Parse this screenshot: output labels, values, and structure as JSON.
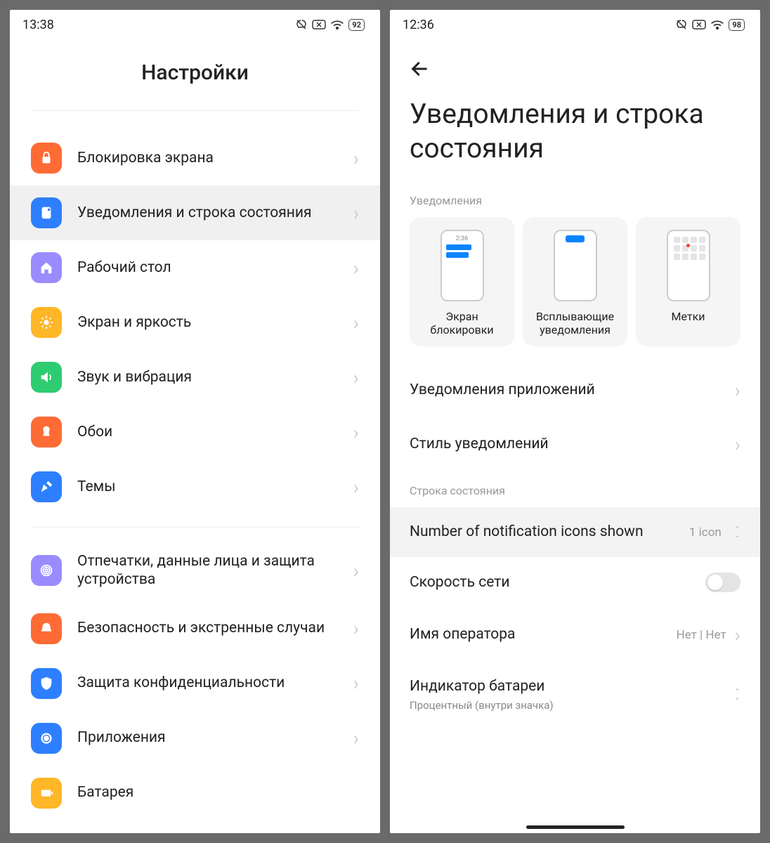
{
  "left": {
    "status": {
      "time": "13:38",
      "battery": "92"
    },
    "title": "Настройки",
    "group1": [
      {
        "id": "lock",
        "label": "Блокировка экрана",
        "color": "#ff6b35"
      },
      {
        "id": "notif",
        "label": "Уведомления и строка состояния",
        "color": "#2e7fff",
        "selected": true
      },
      {
        "id": "home",
        "label": "Рабочий стол",
        "color": "#9a8cff"
      },
      {
        "id": "display",
        "label": "Экран и яркость",
        "color": "#ffb627"
      },
      {
        "id": "sound",
        "label": "Звук и вибрация",
        "color": "#2ecc71"
      },
      {
        "id": "wallpaper",
        "label": "Обои",
        "color": "#ff6b35"
      },
      {
        "id": "themes",
        "label": "Темы",
        "color": "#2e7fff"
      }
    ],
    "group2": [
      {
        "id": "biometric",
        "label": "Отпечатки, данные лица и защита устройства",
        "color": "#9a8cff"
      },
      {
        "id": "security",
        "label": "Безопасность и экстренные случаи",
        "color": "#ff6b35"
      },
      {
        "id": "privacy",
        "label": "Защита конфиденциальности",
        "color": "#2e7fff"
      },
      {
        "id": "apps",
        "label": "Приложения",
        "color": "#2e7fff"
      },
      {
        "id": "battery",
        "label": "Батарея",
        "color": "#ffb627"
      }
    ]
  },
  "right": {
    "status": {
      "time": "12:36",
      "battery": "98"
    },
    "title": "Уведомления и строка состояния",
    "section_notif": "Уведомления",
    "cards": {
      "lockscreen": "Экран блокировки",
      "floating": "Всплывающие уведомления",
      "badges": "Метки",
      "lock_time": "2:36"
    },
    "rows1": [
      {
        "id": "app-notif",
        "label": "Уведомления приложений"
      },
      {
        "id": "notif-style",
        "label": "Стиль уведомлений"
      }
    ],
    "section_status": "Строка состояния",
    "iconcount": {
      "label": "Number of notification icons shown",
      "value": "1 icon"
    },
    "netspeed": {
      "label": "Скорость сети"
    },
    "carrier": {
      "label": "Имя оператора",
      "value": "Нет | Нет"
    },
    "battind": {
      "label": "Индикатор батареи",
      "sub": "Процентный (внутри значка)"
    }
  }
}
